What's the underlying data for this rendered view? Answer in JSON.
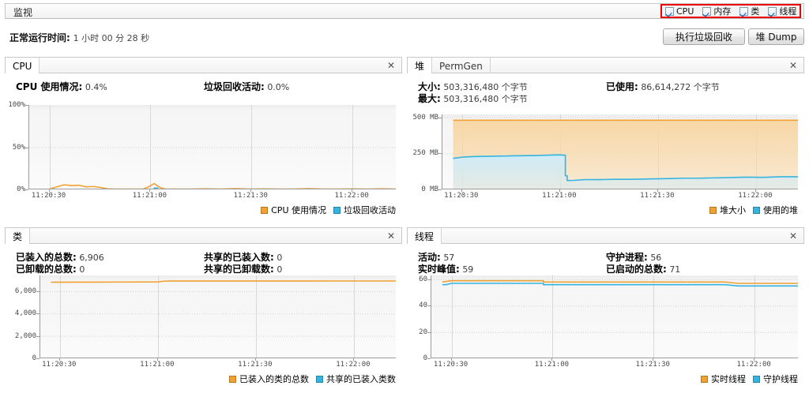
{
  "window": {
    "title": "监视"
  },
  "toggles": {
    "highlight_color": "#ef0000",
    "items": [
      {
        "label": "CPU",
        "checked": true
      },
      {
        "label": "内存",
        "checked": true
      },
      {
        "label": "类",
        "checked": true
      },
      {
        "label": "线程",
        "checked": true
      }
    ]
  },
  "uptime": {
    "key": "正常运行时间:",
    "value": "1 小时 00 分 28 秒"
  },
  "actions": {
    "gc_label": "执行垃圾回收",
    "dump_label": "堆 Dump"
  },
  "colors": {
    "orange": "#f0a132",
    "blue": "#36b4e0",
    "orange_fill": "#f7d7a6",
    "blue_fill": "#cfecf9"
  },
  "close_glyph": "✕",
  "panels": {
    "cpu": {
      "tabs": [
        {
          "label": "CPU",
          "selected": true
        }
      ],
      "stats": [
        {
          "key": "CPU 使用情况:",
          "value": "0.4%",
          "col": "A"
        },
        {
          "key": "垃圾回收活动:",
          "value": "0.0%",
          "col": "B"
        }
      ],
      "legend": [
        {
          "label": "CPU 使用情况",
          "color": "#f0a132"
        },
        {
          "label": "垃圾回收活动",
          "color": "#36b4e0"
        }
      ]
    },
    "heap": {
      "tabs": [
        {
          "label": "堆",
          "selected": true
        },
        {
          "label": "PermGen",
          "selected": false
        }
      ],
      "stats": [
        {
          "key": "大小:",
          "value": "503,316,480 个字节",
          "col": "A"
        },
        {
          "key": "已使用:",
          "value": "86,614,272 个字节",
          "col": "B"
        },
        {
          "key": "最大:",
          "value": "503,316,480 个字节",
          "col": "A"
        }
      ],
      "legend": [
        {
          "label": "堆大小",
          "color": "#f0a132"
        },
        {
          "label": "使用的堆",
          "color": "#36b4e0"
        }
      ]
    },
    "classes": {
      "tabs": [
        {
          "label": "类",
          "selected": true
        }
      ],
      "stats": [
        {
          "key": "已装入的总数:",
          "value": "6,906",
          "col": "A"
        },
        {
          "key": "共享的已装入数:",
          "value": "0",
          "col": "B"
        },
        {
          "key": "已卸载的总数:",
          "value": "0",
          "col": "A"
        },
        {
          "key": "共享的已卸载数:",
          "value": "0",
          "col": "B"
        }
      ],
      "legend": [
        {
          "label": "已装入的类的总数",
          "color": "#f0a132"
        },
        {
          "label": "共享的已装入类数",
          "color": "#36b4e0"
        }
      ]
    },
    "threads": {
      "tabs": [
        {
          "label": "线程",
          "selected": true
        }
      ],
      "stats": [
        {
          "key": "活动:",
          "value": "57",
          "col": "A"
        },
        {
          "key": "守护进程:",
          "value": "56",
          "col": "B"
        },
        {
          "key": "实时峰值:",
          "value": "59",
          "col": "A"
        },
        {
          "key": "已启动的总数:",
          "value": "71",
          "col": "B"
        }
      ],
      "legend": [
        {
          "label": "实时线程",
          "color": "#f0a132"
        },
        {
          "label": "守护线程",
          "color": "#36b4e0"
        }
      ]
    }
  },
  "chart_data": [
    {
      "id": "cpu",
      "type": "line",
      "title": "CPU",
      "xlabel": "",
      "ylabel": "",
      "grid": true,
      "legend_position": "bottom-right",
      "ytick_labels": [
        "100%",
        "50%",
        "0%"
      ],
      "ytick_values": [
        100,
        50,
        0
      ],
      "ylim": [
        0,
        100
      ],
      "xtick_labels": [
        "11:20:30",
        "11:21:00",
        "11:21:30",
        "11:22:00"
      ],
      "xtick_positions": [
        0.055,
        0.33,
        0.605,
        0.88
      ],
      "series": [
        {
          "name": "CPU 使用情况",
          "color": "#f0a132",
          "x": [
            0.055,
            0.075,
            0.095,
            0.115,
            0.135,
            0.155,
            0.175,
            0.195,
            0.215,
            0.235,
            0.26,
            0.29,
            0.31,
            0.325,
            0.34,
            0.355,
            0.37,
            0.4,
            0.44,
            0.48,
            0.52,
            0.56,
            0.6,
            0.64,
            0.68,
            0.72,
            0.76,
            0.8,
            0.84,
            0.88,
            0.92,
            0.96,
            1.0
          ],
          "y": [
            0.4,
            3.0,
            5.5,
            4.5,
            5.0,
            3.0,
            3.5,
            2.2,
            0.6,
            0.4,
            0.4,
            0.4,
            0.4,
            3.0,
            7.0,
            2.5,
            0.4,
            0.4,
            0.4,
            0.8,
            0.4,
            1.0,
            0.4,
            0.6,
            0.4,
            0.4,
            1.0,
            0.4,
            0.4,
            0.6,
            0.4,
            0.8,
            0.4
          ]
        },
        {
          "name": "垃圾回收活动",
          "color": "#36b4e0",
          "x": [
            0.055,
            0.2,
            0.33,
            0.34,
            0.35,
            0.4,
            0.6,
            0.8,
            1.0
          ],
          "y": [
            0.0,
            0.0,
            0.0,
            1.6,
            0.0,
            0.0,
            0.0,
            0.0,
            0.0
          ]
        }
      ]
    },
    {
      "id": "heap",
      "type": "area",
      "title": "堆",
      "xlabel": "",
      "ylabel": "",
      "grid": true,
      "legend_position": "bottom-right",
      "ytick_labels": [
        "500 MB",
        "250 MB",
        "0 MB"
      ],
      "ytick_values": [
        500,
        250,
        0
      ],
      "ylim": [
        0,
        520
      ],
      "xtick_labels": [
        "11:20:30",
        "11:21:00",
        "11:21:30",
        "11:22:00"
      ],
      "xtick_positions": [
        0.055,
        0.33,
        0.605,
        0.88
      ],
      "series": [
        {
          "name": "堆大小",
          "color": "#f0a132",
          "fill": "#f7d7a6",
          "x": [
            0.03,
            1.0
          ],
          "y": [
            480,
            480
          ]
        },
        {
          "name": "使用的堆",
          "color": "#36b4e0",
          "fill": "#cfecf9",
          "x": [
            0.03,
            0.06,
            0.09,
            0.14,
            0.2,
            0.26,
            0.3,
            0.325,
            0.34,
            0.345,
            0.35,
            0.37,
            0.4,
            0.44,
            0.48,
            0.53,
            0.58,
            0.63,
            0.68,
            0.72,
            0.76,
            0.8,
            0.85,
            0.9,
            0.95,
            1.0
          ],
          "y": [
            215,
            225,
            228,
            230,
            233,
            235,
            238,
            240,
            238,
            95,
            62,
            63,
            68,
            68,
            70,
            70,
            73,
            75,
            78,
            78,
            80,
            82,
            85,
            84,
            88,
            88
          ]
        }
      ]
    },
    {
      "id": "classes",
      "type": "line",
      "title": "类",
      "xlabel": "",
      "ylabel": "",
      "grid": true,
      "legend_position": "bottom-right",
      "ytick_labels": [
        "6,000",
        "4,000",
        "2,000",
        "0"
      ],
      "ytick_values": [
        6000,
        4000,
        2000,
        0
      ],
      "ylim": [
        0,
        7400
      ],
      "xtick_labels": [
        "11:20:30",
        "11:21:00",
        "11:21:30",
        "11:22:00"
      ],
      "xtick_positions": [
        0.055,
        0.33,
        0.605,
        0.88
      ],
      "series": [
        {
          "name": "已装入的类的总数",
          "color": "#f0a132",
          "x": [
            0.03,
            0.2,
            0.33,
            0.345,
            0.36,
            0.5,
            0.7,
            0.85,
            1.0
          ],
          "y": [
            6800,
            6810,
            6820,
            6880,
            6900,
            6902,
            6904,
            6906,
            6906
          ]
        },
        {
          "name": "共享的已装入类数",
          "color": "#36b4e0",
          "x": [
            0.03,
            1.0
          ],
          "y": [
            0,
            0
          ]
        }
      ]
    },
    {
      "id": "threads",
      "type": "line",
      "title": "线程",
      "xlabel": "",
      "ylabel": "",
      "grid": true,
      "legend_position": "bottom-right",
      "ytick_labels": [
        "60",
        "40",
        "20",
        "0"
      ],
      "ytick_values": [
        60,
        40,
        20,
        0
      ],
      "ylim": [
        0,
        63
      ],
      "xtick_labels": [
        "11:20:30",
        "11:21:00",
        "11:21:30",
        "11:22:00"
      ],
      "xtick_positions": [
        0.055,
        0.33,
        0.605,
        0.88
      ],
      "series": [
        {
          "name": "实时线程",
          "color": "#f0a132",
          "x": [
            0.03,
            0.055,
            0.08,
            0.15,
            0.25,
            0.3,
            0.305,
            0.32,
            0.4,
            0.55,
            0.7,
            0.8,
            0.835,
            0.85,
            0.9,
            1.0
          ],
          "y": [
            58,
            59,
            59,
            59,
            59,
            59,
            58,
            58,
            58,
            58,
            58,
            58,
            57,
            57,
            57,
            57
          ]
        },
        {
          "name": "守护线程",
          "color": "#36b4e0",
          "x": [
            0.03,
            0.04,
            0.055,
            0.08,
            0.15,
            0.25,
            0.3,
            0.305,
            0.32,
            0.4,
            0.55,
            0.7,
            0.8,
            0.835,
            0.85,
            0.9,
            1.0
          ],
          "y": [
            56,
            56,
            57,
            57,
            57,
            57,
            57,
            56,
            56,
            56,
            56,
            56,
            56,
            55,
            55,
            55,
            55
          ]
        }
      ]
    }
  ]
}
